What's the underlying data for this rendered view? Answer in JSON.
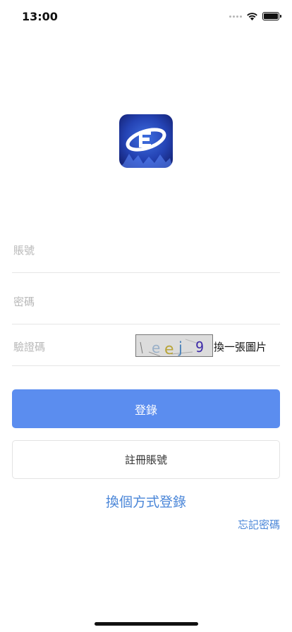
{
  "status_bar": {
    "time": "13:00",
    "icons": [
      "signal-icon",
      "wifi-icon",
      "battery-icon"
    ]
  },
  "logo": {
    "icon": "app-logo-icon",
    "colors": {
      "dark": "#1a2a8a",
      "light": "#3f6fe0"
    }
  },
  "form": {
    "account_placeholder": "賬號",
    "password_placeholder": "密碼",
    "captcha_placeholder": "驗證碼",
    "captcha_text": "eej 9",
    "refresh_captcha_label": "換一張圖片"
  },
  "actions": {
    "login_label": "登錄",
    "register_label": "註冊賬號",
    "alt_login_label": "換個方式登錄",
    "forgot_label": "忘記密碼"
  },
  "colors": {
    "primary": "#5b8def",
    "link": "#4a86d8"
  }
}
